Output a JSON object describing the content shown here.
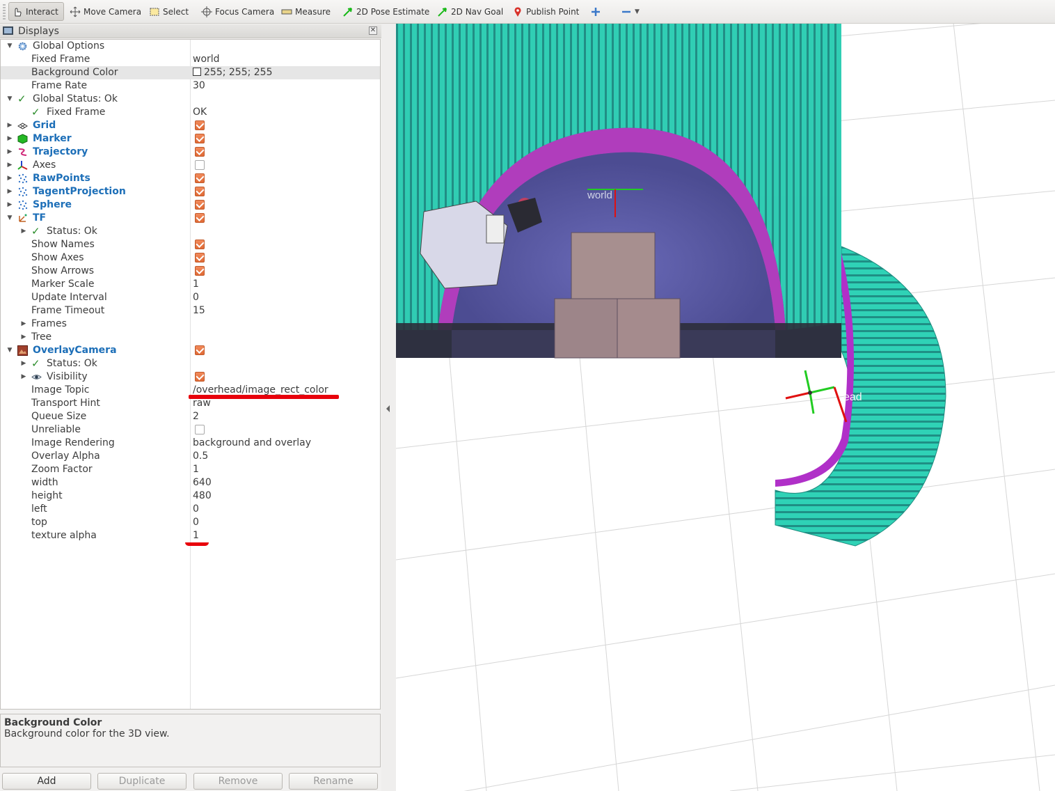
{
  "toolbar": {
    "tools": [
      {
        "label": "Interact",
        "icon": "hand-cursor-icon"
      },
      {
        "label": "Move Camera",
        "icon": "move-camera-icon"
      },
      {
        "label": "Select",
        "icon": "select-box-icon"
      },
      {
        "label": "Focus Camera",
        "icon": "focus-target-icon"
      },
      {
        "label": "Measure",
        "icon": "ruler-icon"
      },
      {
        "label": "2D Pose Estimate",
        "icon": "green-arrow-icon"
      },
      {
        "label": "2D Nav Goal",
        "icon": "green-arrow-icon"
      },
      {
        "label": "Publish Point",
        "icon": "map-pin-icon"
      }
    ],
    "add_tool": "plus-icon",
    "remove_tool": "minus-icon"
  },
  "displays": {
    "title": "Displays",
    "rows": [
      {
        "label": "Global Options",
        "value": ""
      },
      {
        "label": "Fixed Frame",
        "value": "world"
      },
      {
        "label": "Background Color",
        "value": "255; 255; 255"
      },
      {
        "label": "Frame Rate",
        "value": "30"
      },
      {
        "label": "Global Status: Ok",
        "value": ""
      },
      {
        "label": "Fixed Frame",
        "value": "OK"
      },
      {
        "label": "Grid",
        "value": ""
      },
      {
        "label": "Marker",
        "value": ""
      },
      {
        "label": "Trajectory",
        "value": ""
      },
      {
        "label": "Axes",
        "value": ""
      },
      {
        "label": "RawPoints",
        "value": ""
      },
      {
        "label": "TagentProjection",
        "value": ""
      },
      {
        "label": "Sphere",
        "value": ""
      },
      {
        "label": "TF",
        "value": ""
      },
      {
        "label": "Status: Ok",
        "value": ""
      },
      {
        "label": "Show Names",
        "value": ""
      },
      {
        "label": "Show Axes",
        "value": ""
      },
      {
        "label": "Show Arrows",
        "value": ""
      },
      {
        "label": "Marker Scale",
        "value": "1"
      },
      {
        "label": "Update Interval",
        "value": "0"
      },
      {
        "label": "Frame Timeout",
        "value": "15"
      },
      {
        "label": "Frames",
        "value": ""
      },
      {
        "label": "Tree",
        "value": ""
      },
      {
        "label": "OverlayCamera",
        "value": ""
      },
      {
        "label": "Status: Ok",
        "value": ""
      },
      {
        "label": "Visibility",
        "value": ""
      },
      {
        "label": "Image Topic",
        "value": "/overhead/image_rect_color"
      },
      {
        "label": "Transport Hint",
        "value": "raw"
      },
      {
        "label": "Queue Size",
        "value": "2"
      },
      {
        "label": "Unreliable",
        "value": ""
      },
      {
        "label": "Image Rendering",
        "value": "background and overlay"
      },
      {
        "label": "Overlay Alpha",
        "value": "0.5"
      },
      {
        "label": "Zoom Factor",
        "value": "1"
      },
      {
        "label": "width",
        "value": "640"
      },
      {
        "label": "height",
        "value": "480"
      },
      {
        "label": "left",
        "value": "0"
      },
      {
        "label": "top",
        "value": "0"
      },
      {
        "label": "texture alpha",
        "value": "1"
      }
    ],
    "checkbox_states": {
      "grid": true,
      "marker": true,
      "trajectory": true,
      "axes": false,
      "rawpoints": true,
      "tagentprojection": true,
      "sphere": true,
      "tf": true,
      "show_names": true,
      "show_axes": true,
      "show_arrows": true,
      "overlaycamera": true,
      "visibility": true,
      "unreliable": false
    }
  },
  "description": {
    "title": "Background Color",
    "text": "Background color for the 3D view."
  },
  "buttons": {
    "add": "Add",
    "duplicate": "Duplicate",
    "remove": "Remove",
    "rename": "Rename"
  },
  "view": {
    "frame_labels": {
      "world": "world",
      "head": "ead"
    },
    "colors": {
      "background": "#ffffff",
      "grid": "#d6d6d6",
      "teal": "#35e8c8",
      "magenta": "#b030c8",
      "annotation_red": "#e8000b"
    }
  }
}
